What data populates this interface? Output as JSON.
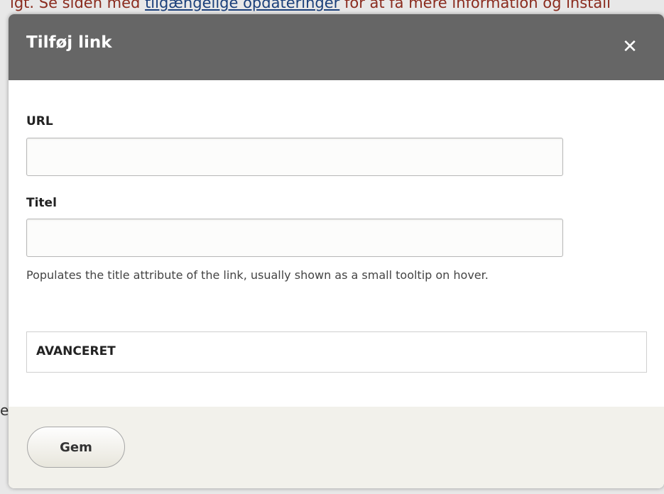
{
  "background": {
    "text_before": "lgt. Se siden med ",
    "link_text": "tilgængelige opdateringer",
    "text_after": " for at få mere information og install",
    "fragment": "e"
  },
  "dialog": {
    "title": "Tilføj link",
    "close_glyph": "✕",
    "url": {
      "label": "URL",
      "value": "",
      "placeholder": ""
    },
    "title_field": {
      "label": "Titel",
      "value": "",
      "placeholder": "",
      "help": "Populates the title attribute of the link, usually shown as a small tooltip on hover."
    },
    "advanced_label": "AVANCERET",
    "save_label": "Gem"
  },
  "colors": {
    "titlebar": "#666666",
    "footer": "#f2f1eb",
    "background_text": "#8a2b1e",
    "background_link": "#1a3f7a"
  }
}
